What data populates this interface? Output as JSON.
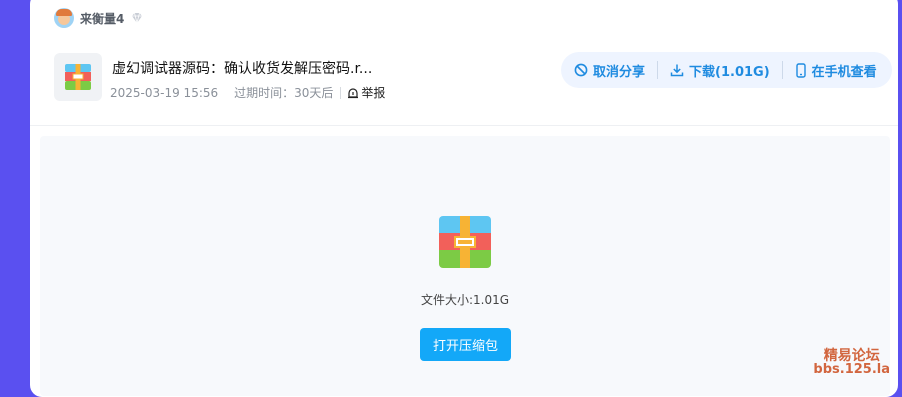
{
  "user": {
    "name": "来衡量4",
    "badge_icon": "vip-diamond-icon"
  },
  "file": {
    "title": "虚幻调试器源码：确认收货发解压密码.r...",
    "date": "2025-03-19 15:56",
    "expiry": "过期时间：30天后",
    "report_label": "举报",
    "icon": "archive-icon"
  },
  "actions": {
    "cancel_share": "取消分享",
    "download": "下载(1.01G)",
    "view_on_phone": "在手机查看"
  },
  "preview": {
    "size_text": "文件大小:1.01G",
    "open_button": "打开压缩包"
  },
  "watermark": {
    "line1": "精易论坛",
    "line2": "bbs.125.la"
  },
  "colors": {
    "accent": "#1f8be0",
    "button": "#13a8f8",
    "background": "#5a50f0",
    "watermark": "#d2663f"
  }
}
